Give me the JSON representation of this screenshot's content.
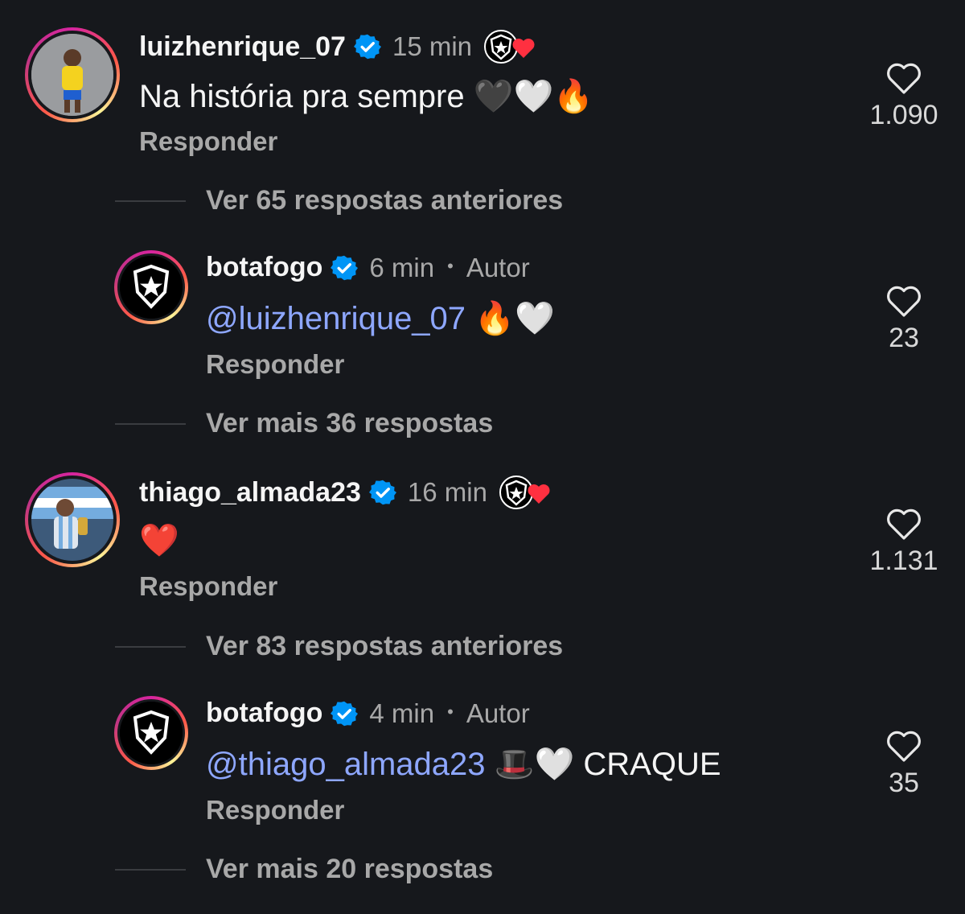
{
  "comments": [
    {
      "username": "luizhenrique_07",
      "time": "15 min",
      "text": "Na história pra sempre",
      "emojis": "🖤🤍🔥",
      "reply_label": "Responder",
      "likes": "1.090",
      "view_replies": "Ver 65 respostas anteriores"
    },
    {
      "username": "botafogo",
      "time": "6 min",
      "author_label": "Autor",
      "mention": "@luizhenrique_07",
      "emojis": "🔥🤍",
      "reply_label": "Responder",
      "likes": "23",
      "view_replies": "Ver mais 36 respostas"
    },
    {
      "username": "thiago_almada23",
      "time": "16 min",
      "emojis": "❤️",
      "reply_label": "Responder",
      "likes": "1.131",
      "view_replies": "Ver 83 respostas anteriores"
    },
    {
      "username": "botafogo",
      "time": "4 min",
      "author_label": "Autor",
      "mention": "@thiago_almada23",
      "emojis": "🎩🤍",
      "text_after": "CRAQUE",
      "reply_label": "Responder",
      "likes": "35",
      "view_replies": "Ver mais 20 respostas"
    }
  ],
  "colors": {
    "background": "#16181c",
    "mention": "#8ea7ff",
    "verified": "#0095f6",
    "heart_red": "#ff3040"
  },
  "icons": [
    "verified-badge-icon",
    "heart-outline-icon",
    "botafogo-star-shield-icon",
    "liked-by-creator-heart-icon"
  ]
}
